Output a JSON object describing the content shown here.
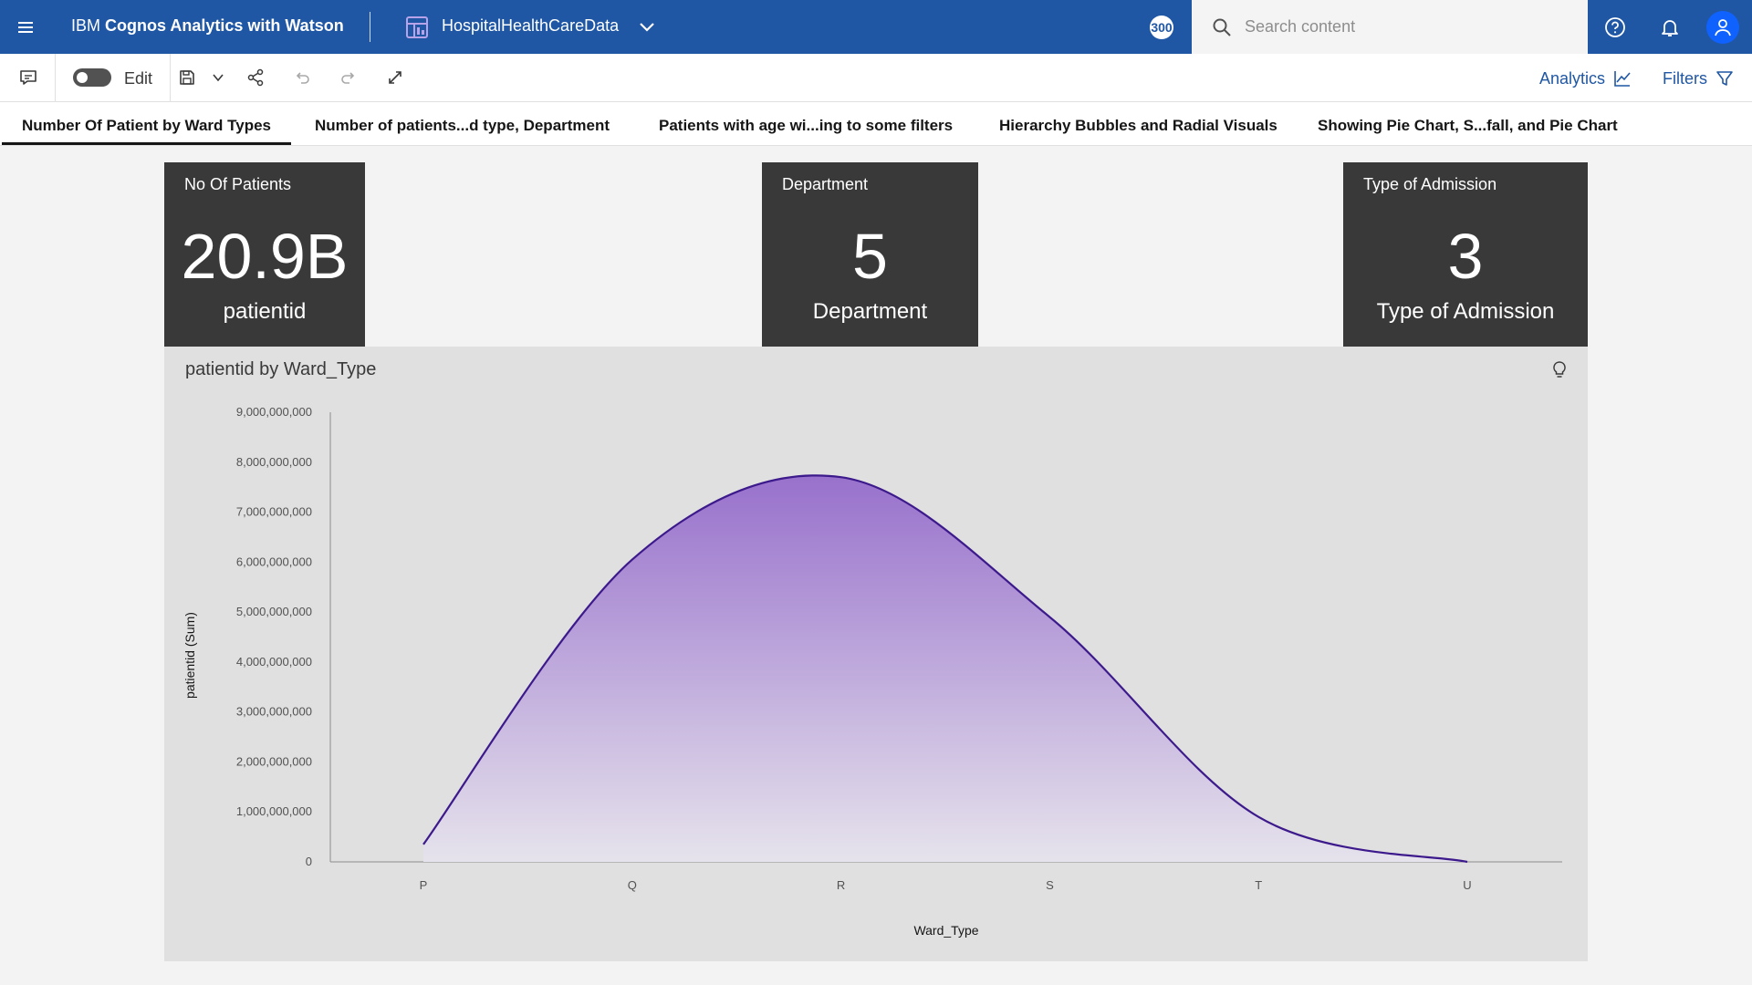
{
  "header": {
    "brand_prefix": "IBM ",
    "brand_bold": "Cognos Analytics with Watson",
    "datasource": "HospitalHealthCareData",
    "count_badge": "300",
    "search_placeholder": "Search content"
  },
  "toolbar": {
    "edit_label": "Edit",
    "analytics_label": "Analytics",
    "filters_label": "Filters"
  },
  "tabs": [
    {
      "label": "Number Of Patient by Ward Types",
      "active": true
    },
    {
      "label": "Number of patients...d type, Department",
      "active": false
    },
    {
      "label": "Patients with age wi...ing to some filters",
      "active": false
    },
    {
      "label": "Hierarchy Bubbles and Radial Visuals",
      "active": false
    },
    {
      "label": "Showing Pie Chart, S...fall, and Pie Chart",
      "active": false
    }
  ],
  "kpis": [
    {
      "title": "No Of Patients",
      "value": "20.9B",
      "sub": "patientid"
    },
    {
      "title": "Department",
      "value": "5",
      "sub": "Department"
    },
    {
      "title": "Type of Admission",
      "value": "3",
      "sub": "Type of Admission"
    }
  ],
  "chart_card": {
    "title": "patientid by Ward_Type"
  },
  "chart_data": {
    "type": "area",
    "title": "patientid by Ward_Type",
    "xlabel": "Ward_Type",
    "ylabel": "patientid (Sum)",
    "categories": [
      "P",
      "Q",
      "R",
      "S",
      "T",
      "U"
    ],
    "values": [
      350000000,
      6050000000,
      7700000000,
      4900000000,
      900000000,
      0
    ],
    "ylim": [
      0,
      9000000000
    ],
    "y_ticks": [
      {
        "value": 0,
        "label": "0"
      },
      {
        "value": 1000000000,
        "label": "1,000,000,000"
      },
      {
        "value": 2000000000,
        "label": "2,000,000,000"
      },
      {
        "value": 3000000000,
        "label": "3,000,000,000"
      },
      {
        "value": 4000000000,
        "label": "4,000,000,000"
      },
      {
        "value": 5000000000,
        "label": "5,000,000,000"
      },
      {
        "value": 6000000000,
        "label": "6,000,000,000"
      },
      {
        "value": 7000000000,
        "label": "7,000,000,000"
      },
      {
        "value": 8000000000,
        "label": "8,000,000,000"
      },
      {
        "value": 9000000000,
        "label": "9,000,000,000"
      }
    ],
    "grid": false,
    "line_color": "#3d1a8c",
    "fill_top_color": "#9871cc",
    "fill_bottom_color": "#e6e3ec"
  },
  "colors": {
    "header_bg": "#1f57a4",
    "accent": "#0f62fe",
    "tile_bg": "#393939"
  }
}
